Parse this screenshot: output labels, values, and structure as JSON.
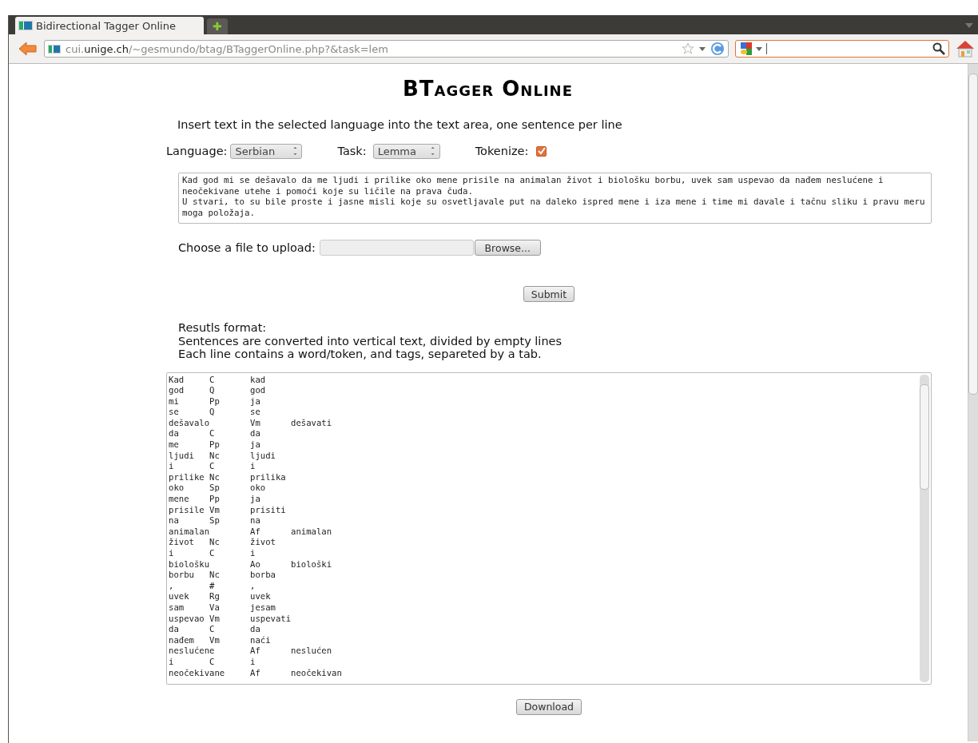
{
  "browser": {
    "tabs": [
      {
        "title": "Bidirectional Tagger Online",
        "selected": true
      }
    ],
    "new_tab": "✚",
    "address": {
      "host_prefix": "cui.",
      "host": "unige.ch",
      "path": "/~gesmundo/btag/BTaggerOnline.php?&task=lem"
    }
  },
  "page": {
    "title": "BTagger Online",
    "instruction": "Insert text in the selected language into the text area, one sentence per line",
    "language": {
      "label": "Language:",
      "value": "Serbian"
    },
    "task": {
      "label": "Task:",
      "value": "Lemma"
    },
    "tokenize": {
      "label": "Tokenize:",
      "checked": true
    },
    "input_text": "Kad god mi se dešavalo da me ljudi i prilike oko mene prisile na animalan život i biološku borbu, uvek sam uspevao da nađem neslućene i neočekivane utehe i pomoći koje su ličile na prava čuda.\nU stvari, to su bile proste i jasne misli koje su osvetljavale put na daleko ispred mene i iza mene i time mi davale i tačnu sliku i pravu meru moga položaja.",
    "upload": {
      "label": "Choose a file to upload:",
      "button": "Browse..."
    },
    "submit": "Submit",
    "results_format": [
      "Resutls format:",
      "Sentences are converted into vertical text, divided by empty lines",
      "Each line contains a word/token, and tags, separeted by a tab."
    ],
    "results": [
      [
        "Kad",
        "C",
        "kad"
      ],
      [
        "god",
        "Q",
        "god"
      ],
      [
        "mi",
        "Pp",
        "ja"
      ],
      [
        "se",
        "Q",
        "se"
      ],
      [
        "dešavalo",
        "Vm",
        "dešavati"
      ],
      [
        "da",
        "C",
        "da"
      ],
      [
        "me",
        "Pp",
        "ja"
      ],
      [
        "ljudi",
        "Nc",
        "ljudi"
      ],
      [
        "i",
        "C",
        "i"
      ],
      [
        "prilike",
        "Nc",
        "prilika"
      ],
      [
        "oko",
        "Sp",
        "oko"
      ],
      [
        "mene",
        "Pp",
        "ja"
      ],
      [
        "prisile",
        "Vm",
        "prisiti"
      ],
      [
        "na",
        "Sp",
        "na"
      ],
      [
        "animalan",
        "Af",
        "animalan"
      ],
      [
        "život",
        "Nc",
        "život"
      ],
      [
        "i",
        "C",
        "i"
      ],
      [
        "biološku",
        "Ao",
        "biološki"
      ],
      [
        "borbu",
        "Nc",
        "borba"
      ],
      [
        ",",
        "#",
        ","
      ],
      [
        "uvek",
        "Rg",
        "uvek"
      ],
      [
        "sam",
        "Va",
        "jesam"
      ],
      [
        "uspevao",
        "Vm",
        "uspevati"
      ],
      [
        "da",
        "C",
        "da"
      ],
      [
        "nađem",
        "Vm",
        "naći"
      ],
      [
        "neslućene",
        "Af",
        "neslućen"
      ],
      [
        "i",
        "C",
        "i"
      ],
      [
        "neočekivane",
        "Af",
        "neočekivan"
      ]
    ],
    "download": "Download"
  }
}
